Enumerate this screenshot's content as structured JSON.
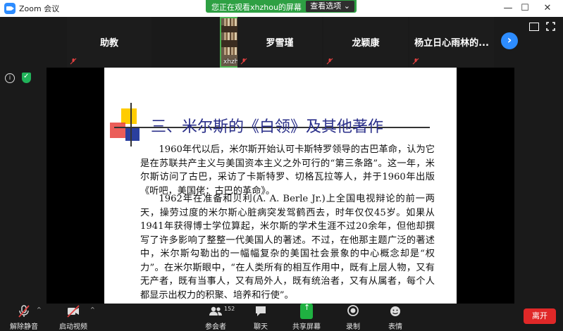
{
  "window": {
    "app_title": "Zoom 会议",
    "controls": {
      "minimize": "—",
      "maximize": "☐",
      "close": "✕"
    }
  },
  "share_banner": {
    "text": "您正在观看xhzhou的屏幕",
    "options_label": "查看选项",
    "options_caret": "⌄"
  },
  "participants": [
    {
      "name": "助教",
      "muted": true
    },
    {
      "name": "xhzhou",
      "video": true
    },
    {
      "name": "罗雪瑾",
      "muted": true
    },
    {
      "name": "龙颖康",
      "muted": true
    },
    {
      "name": "杨立日心雨林的...",
      "muted": true
    }
  ],
  "next_page_glyph": "›",
  "slide": {
    "title": "三、米尔斯的《白领》及其他著作",
    "paragraphs": [
      "1960年代以后，米尔斯开始认可卡斯特罗领导的古巴革命，认为它是在苏联共产主义与美国资本主义之外可行的“第三条路”。这一年，米尔斯访问了古巴，采访了卡斯特罗、切格瓦拉等人，并于1960年出版《听吧，美国佬：古巴的革命》。",
      "1962年在准备和贝利(A. A. Berle Jr.)上全国电视辩论的前一两天，操劳过度的米尔斯心脏病突发驾鹤西去，时年仅仅45岁。如果从1941年获得博士学位算起，米尔斯的学术生涯不过20余年，但他却撰写了许多影响了整整一代美国人的著述。不过，在他那主题广泛的著述中，米尔斯勾勒出的一幅幅复杂的美国社会景象的中心概念却是“权力”。在米尔斯眼中，“在人类所有的相互作用中，既有上层人物，又有无产者，既有当事人，又有局外人，既有统治者，又有从属者，每个人都显示出权力的积聚、培养和行使”。"
    ]
  },
  "toolbar": {
    "mute": {
      "label": "解除静音",
      "icon": "mic-muted-icon"
    },
    "video": {
      "label": "启动视频",
      "icon": "video-off-icon"
    },
    "participants": {
      "label": "参会者",
      "count": "152",
      "icon": "participants-icon"
    },
    "chat": {
      "label": "聊天",
      "icon": "chat-icon"
    },
    "share": {
      "label": "共享屏幕",
      "icon": "share-screen-icon"
    },
    "record": {
      "label": "录制",
      "icon": "record-icon"
    },
    "reactions": {
      "label": "表情",
      "icon": "emoji-icon"
    },
    "caret": "^",
    "leave": "离开"
  },
  "colors": {
    "share_banner": "#2ea043",
    "zoom_blue": "#2D8CFF",
    "leave_red": "#e02828",
    "slide_title": "#2a2f8a"
  }
}
